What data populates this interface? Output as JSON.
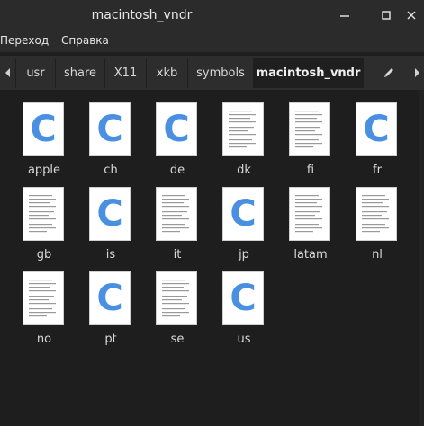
{
  "window": {
    "title": "macintosh_vndr",
    "controls": [
      "minimize-icon",
      "maximize-icon",
      "close-icon"
    ]
  },
  "menu": {
    "items": [
      {
        "label": "Переход"
      },
      {
        "label": "Справка"
      }
    ]
  },
  "pathbar": {
    "back_icon": "chevron-left-icon",
    "crumbs": [
      {
        "label": "usr"
      },
      {
        "label": "share"
      },
      {
        "label": "X11"
      },
      {
        "label": "xkb"
      },
      {
        "label": "symbols"
      },
      {
        "label": "macintosh_vndr"
      }
    ],
    "edit_icon": "pencil-icon",
    "forward_icon": "chevron-right-icon"
  },
  "files": [
    {
      "name": "apple",
      "type": "c-source"
    },
    {
      "name": "ch",
      "type": "c-source"
    },
    {
      "name": "de",
      "type": "c-source"
    },
    {
      "name": "dk",
      "type": "text"
    },
    {
      "name": "fi",
      "type": "text"
    },
    {
      "name": "fr",
      "type": "c-source"
    },
    {
      "name": "gb",
      "type": "text"
    },
    {
      "name": "is",
      "type": "c-source"
    },
    {
      "name": "it",
      "type": "text"
    },
    {
      "name": "jp",
      "type": "c-source"
    },
    {
      "name": "latam",
      "type": "text"
    },
    {
      "name": "nl",
      "type": "text"
    },
    {
      "name": "no",
      "type": "text"
    },
    {
      "name": "pt",
      "type": "c-source"
    },
    {
      "name": "se",
      "type": "text"
    },
    {
      "name": "us",
      "type": "c-source"
    }
  ],
  "colors": {
    "c_icon": "#4a90e2",
    "window_bg": "#1e1e1e",
    "chrome_bg": "#2b2b2b"
  }
}
